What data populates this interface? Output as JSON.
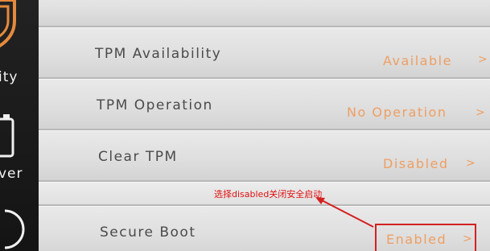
{
  "sidebar": {
    "items": [
      {
        "label": "ity",
        "icon": "shield-icon"
      },
      {
        "label": "ver",
        "icon": "battery-icon"
      },
      {
        "label": "",
        "icon": "power-icon"
      }
    ]
  },
  "settings": [
    {
      "label": "TPM Availability",
      "value": "Available",
      "chevron": ">"
    },
    {
      "label": "TPM Operation",
      "value": "No Operation",
      "chevron": ">"
    },
    {
      "label": "Clear TPM",
      "value": "Disabled",
      "chevron": ">"
    },
    {
      "label": "Secure Boot",
      "value": "Enabled",
      "chevron": ">"
    }
  ],
  "annotation": {
    "text": "选择disabled关闭安全启动",
    "color": "#e01010"
  },
  "colors": {
    "accent": "#ee9f63",
    "label": "#4b4b4b",
    "sidebar": "#1a1a1a"
  }
}
